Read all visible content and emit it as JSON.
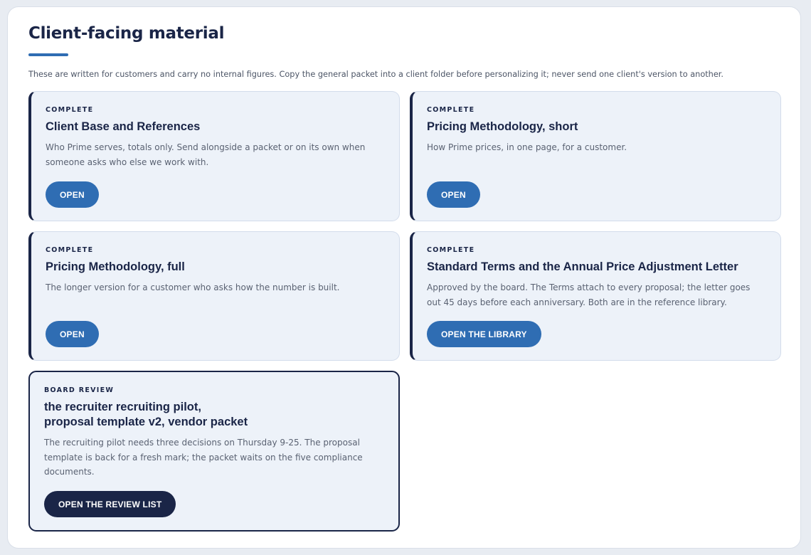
{
  "page": {
    "title": "Client-facing material",
    "intro": "These are written for customers and carry no internal figures. Copy the general packet into a client folder before personalizing it; never send one client's version to another."
  },
  "cards": [
    {
      "status": "COMPLETE",
      "title": "Client Base and References",
      "description": "Who Prime serves, totals only. Send alongside a packet or on its own when someone asks who else we work with.",
      "button": "OPEN"
    },
    {
      "status": "COMPLETE",
      "title": "Pricing Methodology, short",
      "description": "How Prime prices, in one page, for a customer.",
      "button": "OPEN"
    },
    {
      "status": "COMPLETE",
      "title": "Pricing Methodology, full",
      "description": "The longer version for a customer who asks how the number is built.",
      "button": "OPEN"
    },
    {
      "status": "COMPLETE",
      "title": "Standard Terms and the Annual Price Adjustment Letter",
      "description": "Approved by the board. The Terms attach to every proposal; the letter goes out 45 days before each anniversary. Both are in the reference library.",
      "button": "OPEN THE LIBRARY"
    }
  ],
  "review": {
    "status": "BOARD REVIEW",
    "title_line1": "the recruiter recruiting pilot,",
    "title_line2": "proposal template v2, vendor packet",
    "description": "The recruiting pilot needs three decisions on Thursday 9-25. The proposal template is back for a fresh mark; the packet waits on the five compliance documents.",
    "button": "OPEN THE REVIEW LIST"
  },
  "colors": {
    "accent": "#2f6db3",
    "navy": "#1a2547",
    "card_bg": "#edf2f9"
  }
}
